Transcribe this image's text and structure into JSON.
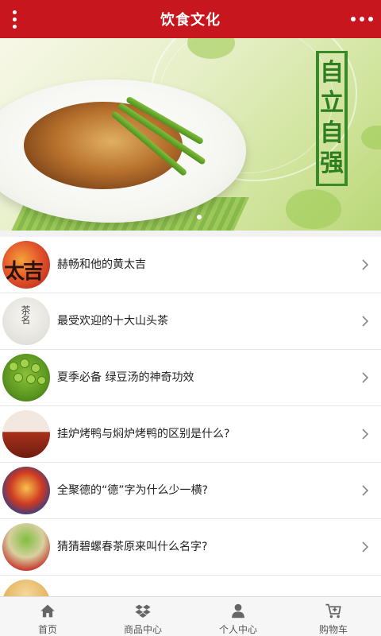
{
  "header": {
    "title": "饮食文化",
    "left_icon": "vertical-dots-icon",
    "right_icon": "horizontal-dots-icon",
    "background": "#c8161e"
  },
  "banner": {
    "slogan_open": "『",
    "slogan_chars": [
      "自",
      "立",
      "自",
      "强"
    ],
    "slogan_close": "』",
    "slogan_color": "#2e7d1f"
  },
  "articles": [
    {
      "title": "赫畅和他的黄太吉",
      "thumb_text": "太吉"
    },
    {
      "title": "最受欢迎的十大山头茶",
      "thumb_text": "茶名"
    },
    {
      "title": "夏季必备  绿豆汤的神奇功效"
    },
    {
      "title": "挂炉烤鸭与焖炉烤鸭的区别是什么?"
    },
    {
      "title": "全聚德的“德”字为什么少一横?"
    },
    {
      "title": "猜猜碧螺春茶原来叫什么名字?"
    },
    {
      "title": ""
    }
  ],
  "tabbar": {
    "items": [
      {
        "label": "首页",
        "icon": "home-icon"
      },
      {
        "label": "商品中心",
        "icon": "dropbox-icon"
      },
      {
        "label": "个人中心",
        "icon": "user-icon"
      },
      {
        "label": "购物车",
        "icon": "cart-icon"
      }
    ]
  }
}
